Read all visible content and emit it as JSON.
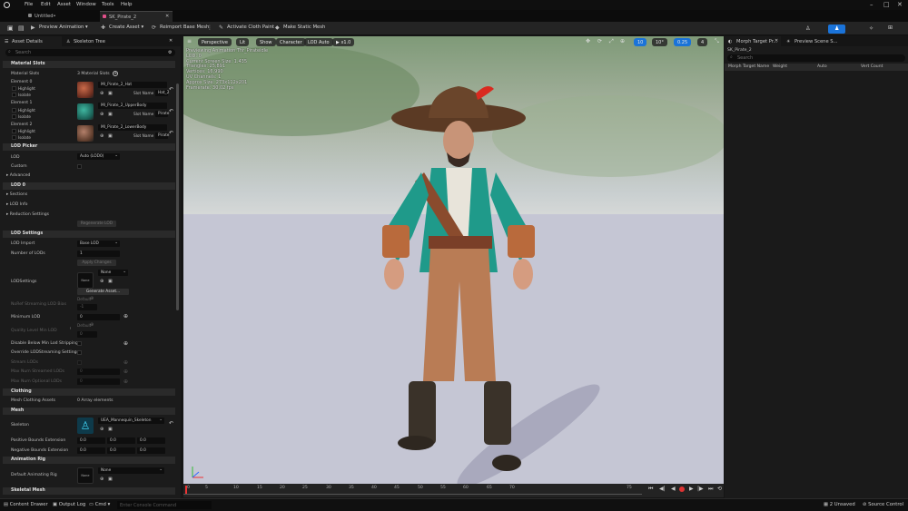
{
  "menu": [
    "File",
    "Edit",
    "Asset",
    "Window",
    "Tools",
    "Help"
  ],
  "tabs": {
    "untitled": "Untitled•",
    "asset": "SK_Pirate_2"
  },
  "toolbar": {
    "preview_animation": "Preview Animation ▾",
    "create_asset": "Create Asset ▾",
    "reimport": "Reimport Base Mesh",
    "cloth": "Activate Cloth Paint",
    "static_mesh": "Make Static Mesh"
  },
  "left": {
    "tab1": "Asset Details",
    "tab2": "Skeleton Tree",
    "search": "Search",
    "cat_material": "Material Slots",
    "material_slots_label": "Material Slots",
    "material_slots_value": "3 Material Slots",
    "elements": [
      {
        "label": "Element 0",
        "mat": "MI_Pirate_2_Hat",
        "slot": "Hat_2"
      },
      {
        "label": "Element 1",
        "mat": "MI_Pirate_2_UpperBody",
        "slot": "Pirate"
      },
      {
        "label": "Element 2",
        "mat": "MI_Pirate_2_LowerBody",
        "slot": "Pirate"
      }
    ],
    "highlight": "Highlight",
    "isolate": "Isolate",
    "slot_name": "Slot Name",
    "cat_lod_picker": "LOD Picker",
    "lod": "LOD",
    "lod_value": "Auto (LOD0)",
    "custom": "Custom",
    "advanced": "Advanced",
    "cat_lod0": "LOD 0",
    "sections": "Sections",
    "lod_info": "LOD Info",
    "reduction": "Reduction Settings",
    "regenerate": "Regenerate LOD",
    "cat_lod_settings": "LOD Settings",
    "lod_import": "LOD Import",
    "lod_import_value": "Base LOD",
    "num_lods": "Number of LODs",
    "num_lods_value": "1",
    "apply_changes": "Apply Changes",
    "lodsettings": "LODSettings",
    "none": "None",
    "generate_asset": "Generate Asset...",
    "nofmt": "NoRef Streaming LOD Bias",
    "default": "Default",
    "minus_one": "-1",
    "min_lod": "Minimum LOD",
    "min_lod_value": "0",
    "quality_level": "Quality Level Min LOD",
    "zero": "0",
    "disable_below": "Disable Below Min Lod Stripping",
    "override_streaming": "Override LODStreaming Settings",
    "stream_lods": "Stream LODs",
    "max_streamed": "Max Num Streamed LODs",
    "max_optional": "Max Num Optional LODs",
    "cat_clothing": "Clothing",
    "mesh_clothing": "Mesh Clothing Assets",
    "array_elems": "0 Array elements",
    "cat_mesh": "Mesh",
    "skeleton": "Skeleton",
    "skeleton_value": "UEA_Mannequin_Skeleton",
    "pos_bounds": "Positive Bounds Extension",
    "neg_bounds": "Negative Bounds Extension",
    "bounds_val": "0.0",
    "cat_anim_rig": "Animation Rig",
    "default_anim_rig": "Default Animating Rig",
    "cat_skeletal_mesh": "Skeletal Mesh"
  },
  "viewport": {
    "perspective": "Perspective",
    "lit": "Lit",
    "show": "Show",
    "character": "Character",
    "lod_auto": "LOD Auto",
    "speed": "x1.0",
    "stats": [
      "Previewing Animation Thr_Pirateidle",
      "LOD: 0",
      "Current Screen Size: 1.435",
      "Triangles: 25,891",
      "Vertices: 16,990",
      "UV Channels: 1",
      "Approx Size: 273x112x201",
      "Framerate: 30,02 fps"
    ],
    "grid_value": "10",
    "angle_value": "10°",
    "scale_value": "0.25",
    "cam_value": "4"
  },
  "timeline": {
    "ticks": [
      "0",
      "5",
      "10",
      "15",
      "20",
      "25",
      "30",
      "35",
      "40",
      "45",
      "50",
      "55",
      "60",
      "65",
      "70",
      "75"
    ]
  },
  "right": {
    "tab1": "Morph Target Pr...",
    "tab2": "Preview Scene S...",
    "asset": "SK_Pirate_2",
    "search": "Search",
    "cols": [
      "Morph Target Name",
      "Weight",
      "Auto",
      "Vert Count"
    ]
  },
  "status": {
    "content_drawer": "Content Drawer",
    "output_log": "Output Log",
    "cmd": "Cmd ▾",
    "console": "Enter Console Command",
    "unsaved": "2 Unsaved",
    "source_control": "Source Control"
  }
}
